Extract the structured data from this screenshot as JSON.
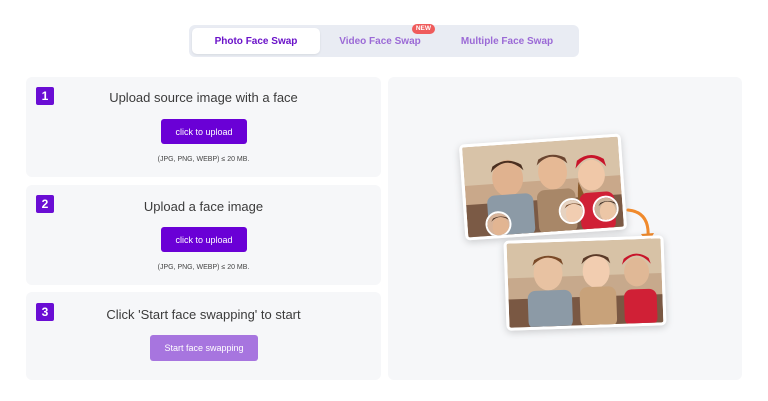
{
  "tabs": [
    {
      "label": "Photo Face Swap",
      "active": true
    },
    {
      "label": "Video Face Swap",
      "badge": "NEW"
    },
    {
      "label": "Multiple Face Swap"
    }
  ],
  "steps": [
    {
      "number": "1",
      "title": "Upload source image with a face",
      "button": "click to upload",
      "note": "(JPG, PNG, WEBP) ≤ 20 MB."
    },
    {
      "number": "2",
      "title": "Upload a face image",
      "button": "click to upload",
      "note": "(JPG, PNG, WEBP) ≤ 20 MB."
    },
    {
      "number": "3",
      "title": "Click 'Start face swapping' to start",
      "button": "Start face swapping"
    }
  ],
  "colors": {
    "accent": "#6a00d6",
    "accent_disabled": "#a775df",
    "tab_text": "#9b6ad6",
    "badge": "#ef5b5b",
    "arrow": "#f08a2c"
  },
  "icons": {
    "swap_arrow": "curved-arrow-icon"
  }
}
